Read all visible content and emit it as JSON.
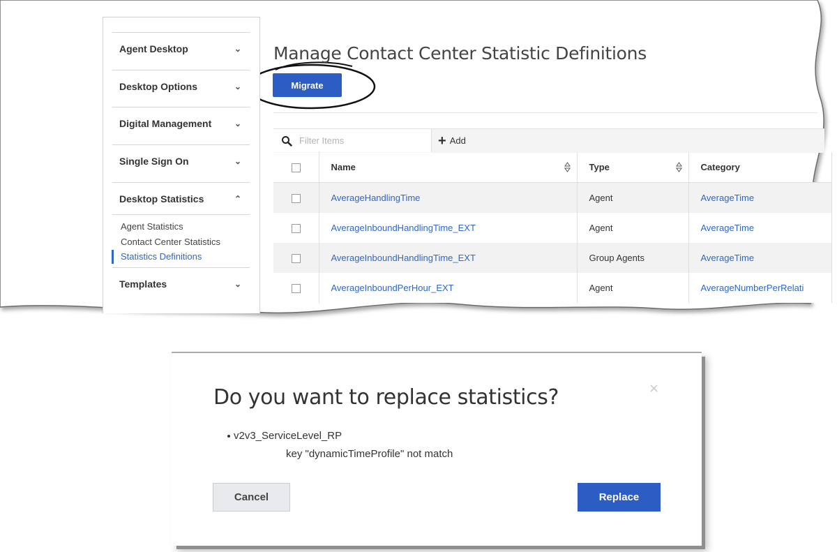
{
  "sidebar": {
    "sections": [
      {
        "label": "Agent Desktop",
        "chevron": "chevron-down-icon",
        "expanded": false
      },
      {
        "label": "Desktop Options",
        "chevron": "chevron-down-icon",
        "expanded": false
      },
      {
        "label": "Digital Management",
        "chevron": "chevron-down-icon",
        "expanded": false
      },
      {
        "label": "Single Sign On",
        "chevron": "chevron-down-icon",
        "expanded": false
      },
      {
        "label": "Desktop Statistics",
        "chevron": "chevron-up-icon",
        "expanded": true,
        "items": [
          "Agent Statistics",
          "Contact Center Statistics",
          "Statistics Definitions"
        ],
        "active_item": "Statistics Definitions"
      },
      {
        "label": "Templates",
        "chevron": "chevron-down-icon",
        "expanded": false
      }
    ]
  },
  "main": {
    "title": "Manage Contact Center Statistic Definitions",
    "migrate_label": "Migrate",
    "filter_placeholder": "Filter Items",
    "add_label": "Add",
    "columns": [
      "Name",
      "Type",
      "Category"
    ],
    "rows": [
      {
        "name": "AverageHandlingTime",
        "type": "Agent",
        "category": "AverageTime"
      },
      {
        "name": "AverageInboundHandlingTime_EXT",
        "type": "Agent",
        "category": "AverageTime"
      },
      {
        "name": "AverageInboundHandlingTime_EXT",
        "type": "Group Agents",
        "category": "AverageTime"
      },
      {
        "name": "AverageInboundPerHour_EXT",
        "type": "Agent",
        "category": "AverageNumberPerRelati"
      }
    ]
  },
  "modal": {
    "title": "Do you want to replace statistics?",
    "close_symbol": "×",
    "item": "v2v3_ServiceLevel_RP",
    "detail": "key \"dynamicTimeProfile\" not match",
    "cancel_label": "Cancel",
    "replace_label": "Replace"
  },
  "colors": {
    "primary": "#2c5dc4",
    "link": "#2f67c7",
    "annotation_ellipse": "#111111"
  },
  "icons": [
    "search-icon",
    "plus-icon",
    "sort-icon",
    "chevron-down-icon",
    "chevron-up-icon",
    "close-icon"
  ]
}
